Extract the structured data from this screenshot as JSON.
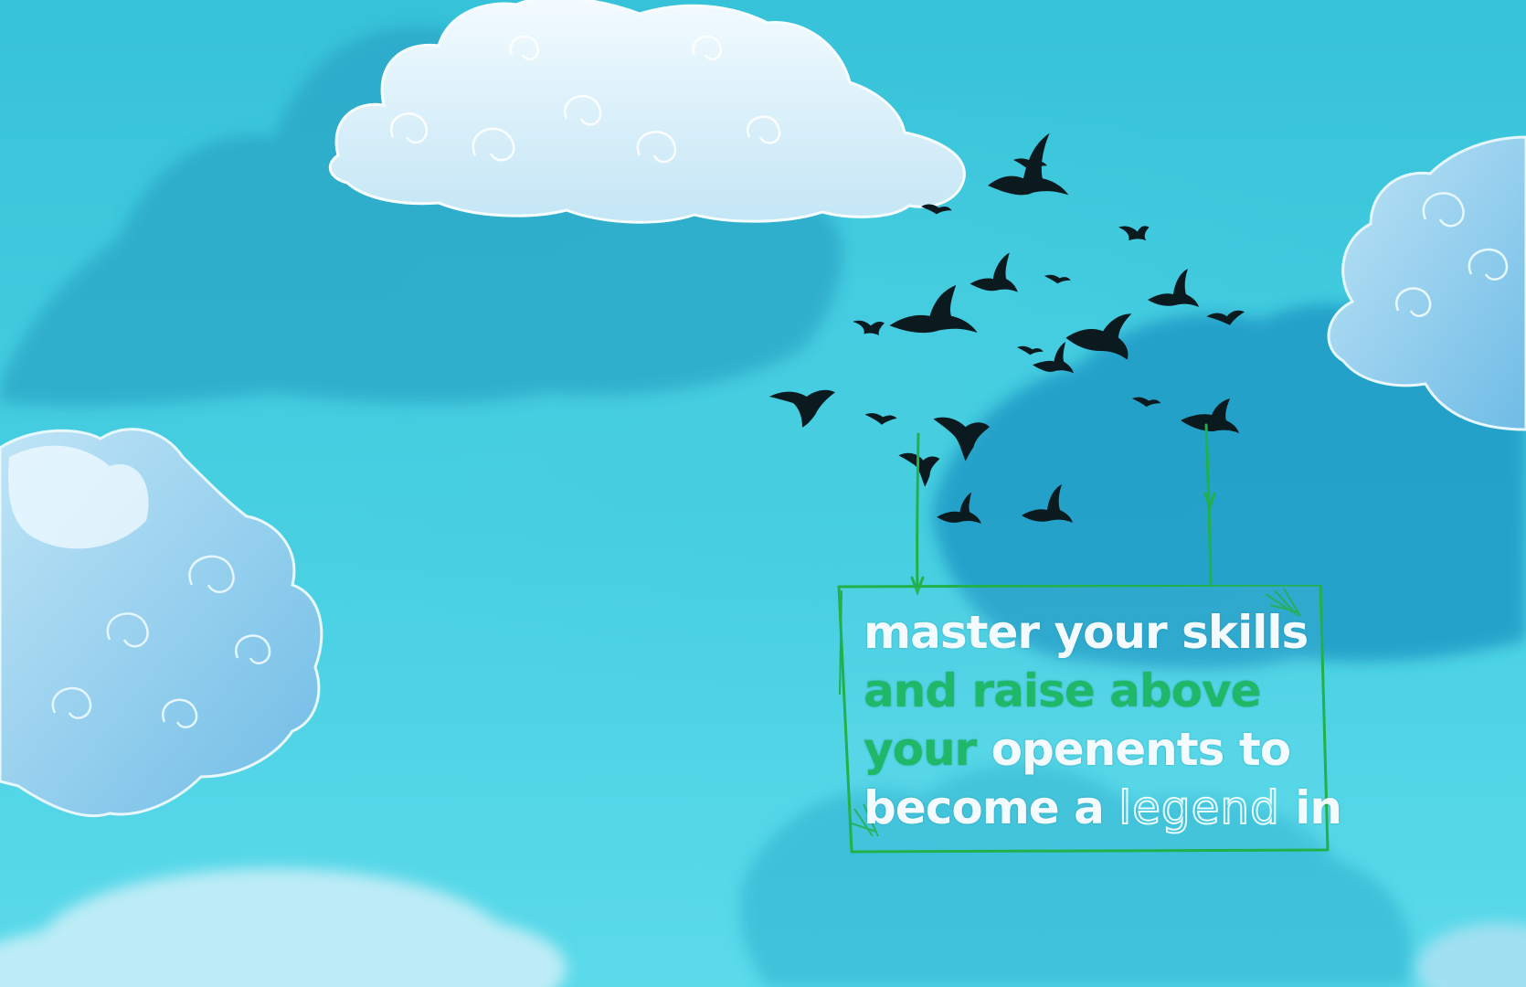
{
  "colors": {
    "sky": "#3ec8dc",
    "cloud_dark": "#2aa9c9",
    "cloud_white": "#eaf6fb",
    "cloud_blue": "#9fd3ee",
    "bird": "#0b1a1f",
    "sign_frame": "#22b04a",
    "text_white": "#f4fbff",
    "text_green": "#1fb869"
  },
  "sign": {
    "line1": {
      "part1": "master your skills"
    },
    "line2": {
      "part1": "and raise above"
    },
    "line3": {
      "part1": "your",
      "part2": "openents to"
    },
    "line4": {
      "part1": "become a",
      "highlight": "legend",
      "part2": "in"
    }
  }
}
